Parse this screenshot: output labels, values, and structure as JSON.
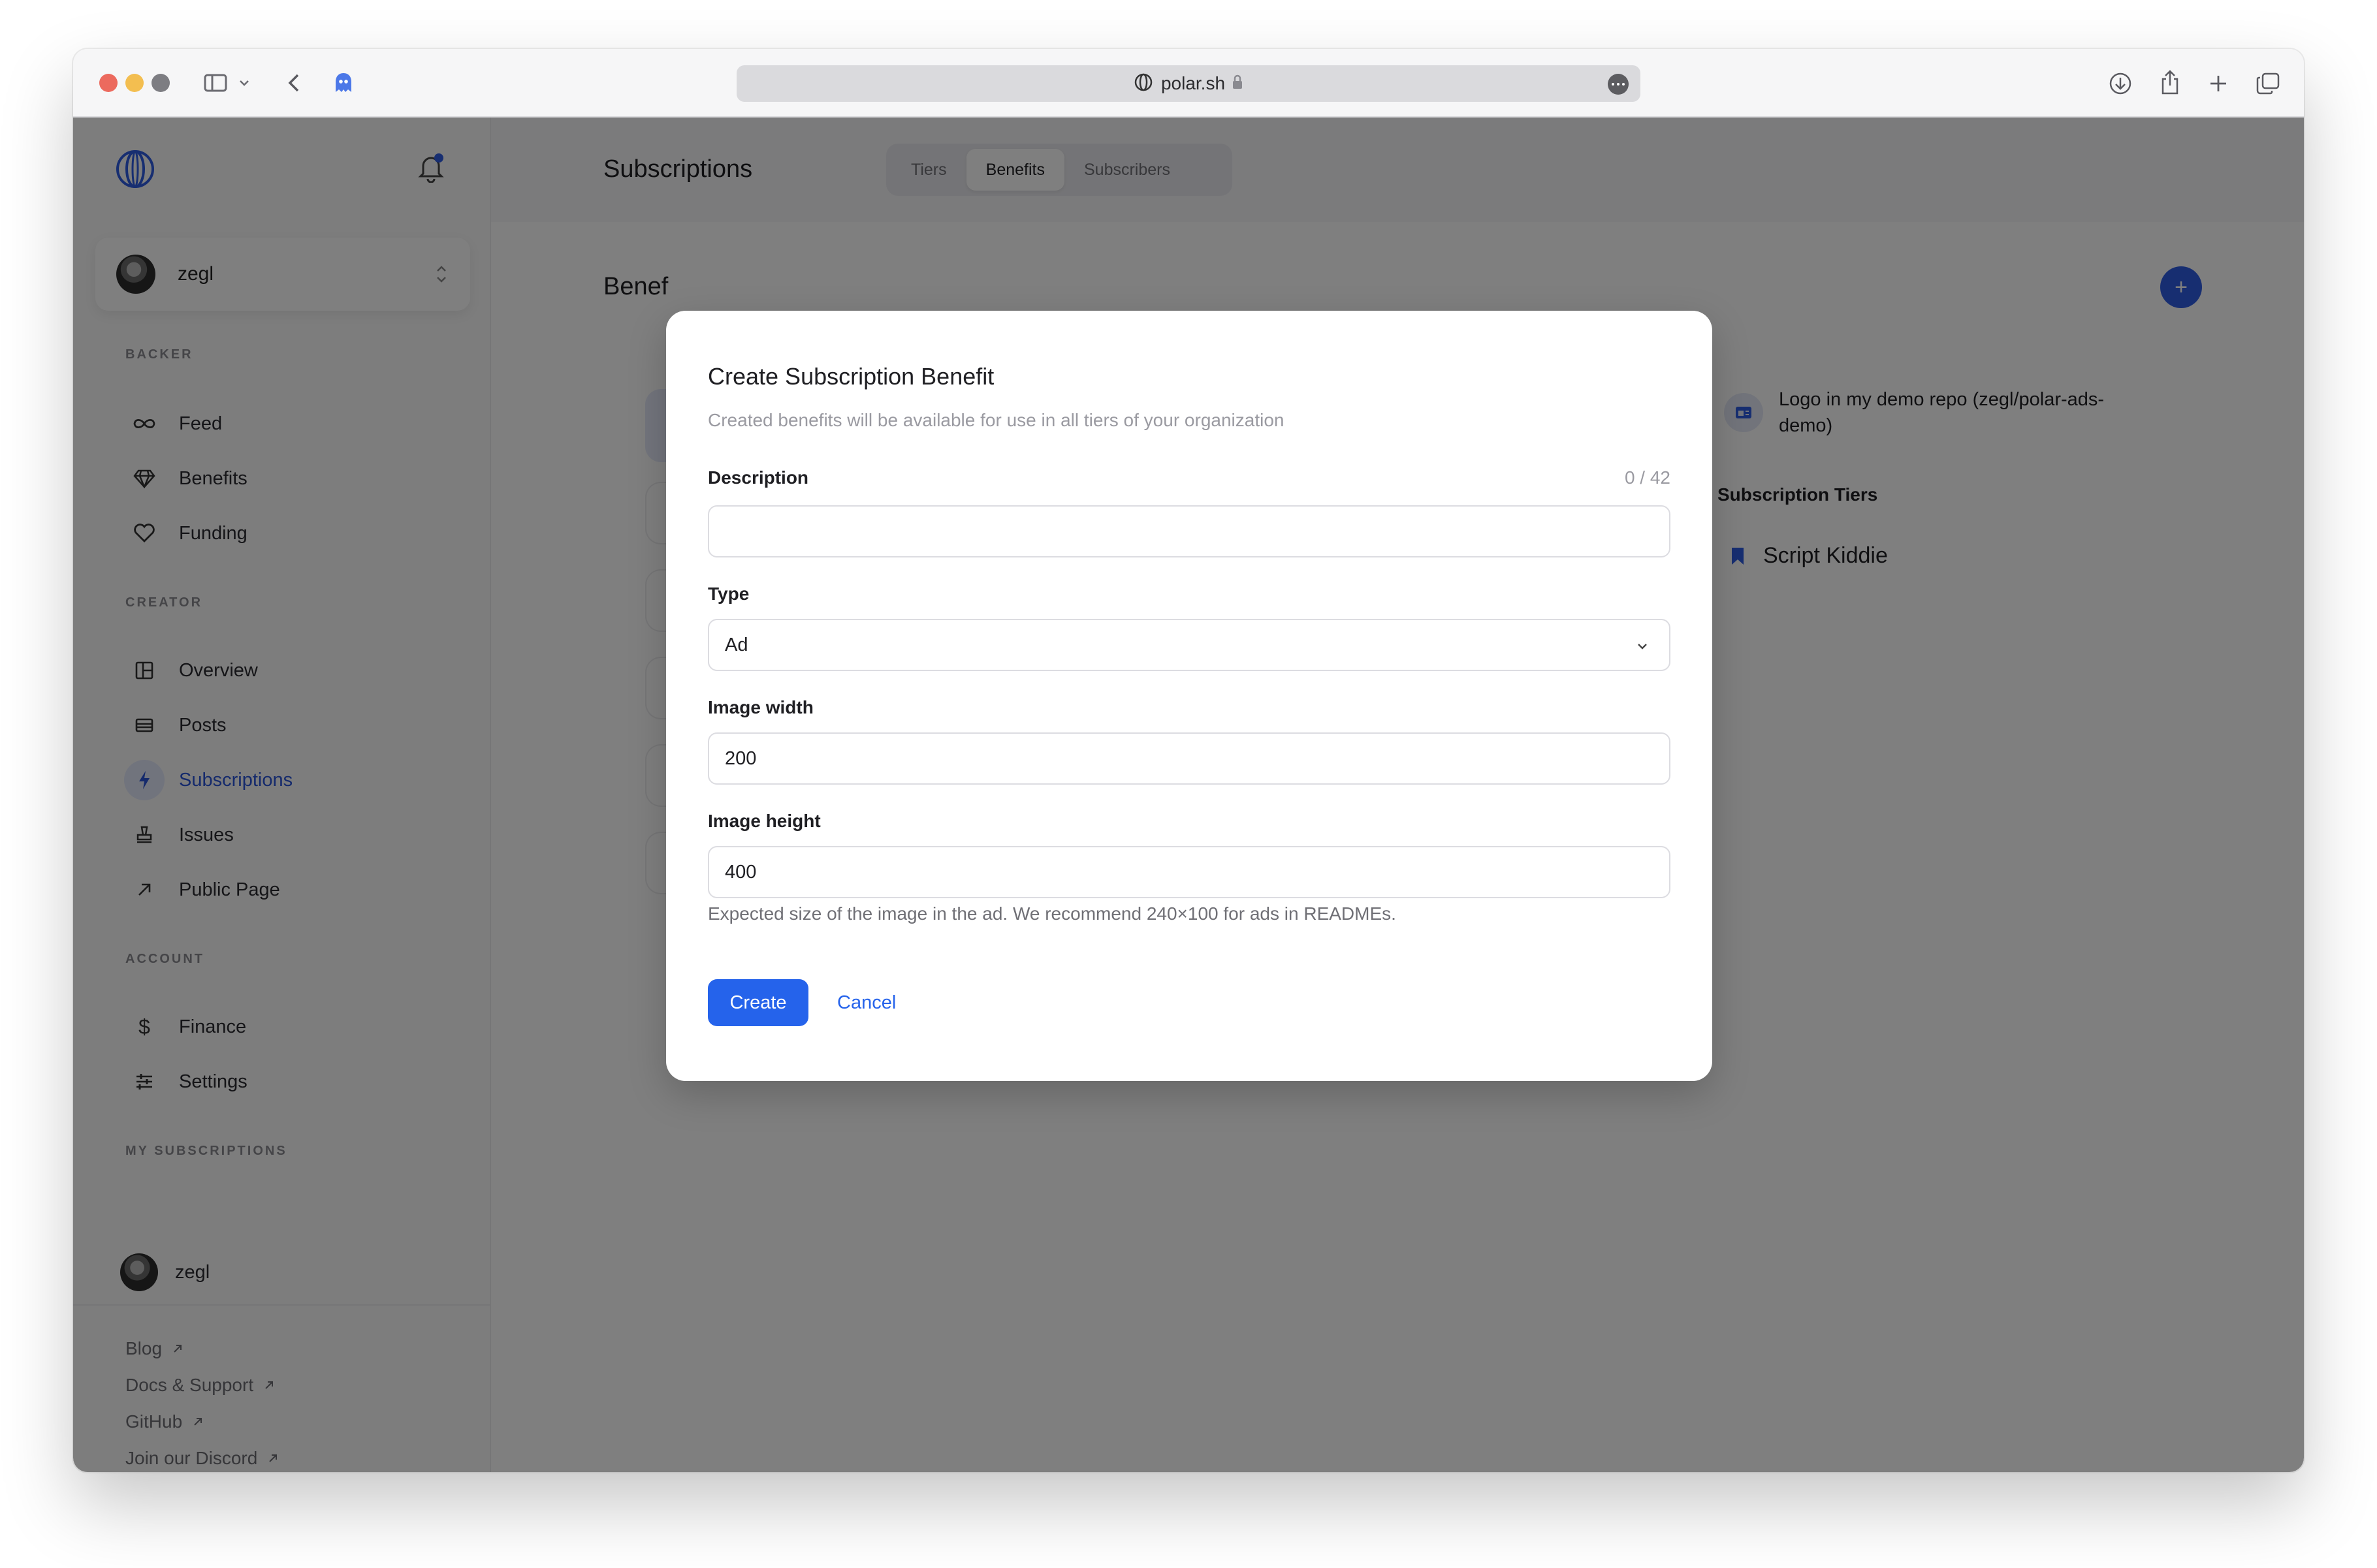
{
  "browser": {
    "url": "polar.sh"
  },
  "sidebar": {
    "account_name": "zegl",
    "sections": {
      "backer": "BACKER",
      "creator": "CREATOR",
      "account": "ACCOUNT",
      "my_subscriptions": "MY SUBSCRIPTIONS"
    },
    "backer_items": [
      {
        "label": "Feed",
        "icon": "infinity-icon"
      },
      {
        "label": "Benefits",
        "icon": "diamond-icon"
      },
      {
        "label": "Funding",
        "icon": "heart-icon"
      }
    ],
    "creator_items": [
      {
        "label": "Overview",
        "icon": "grid-icon"
      },
      {
        "label": "Posts",
        "icon": "posts-icon"
      },
      {
        "label": "Subscriptions",
        "icon": "bolt-icon",
        "active": true
      },
      {
        "label": "Issues",
        "icon": "stamp-icon"
      },
      {
        "label": "Public Page",
        "icon": "arrow-up-right-icon"
      }
    ],
    "account_items": [
      {
        "label": "Finance",
        "icon": "dollar-icon"
      },
      {
        "label": "Settings",
        "icon": "sliders-icon"
      }
    ],
    "subscriptions": [
      {
        "label": "zegl"
      }
    ],
    "footer_links": [
      {
        "label": "Blog"
      },
      {
        "label": "Docs & Support"
      },
      {
        "label": "GitHub"
      },
      {
        "label": "Join our Discord"
      }
    ]
  },
  "header": {
    "title": "Subscriptions",
    "tabs": [
      {
        "label": "Tiers"
      },
      {
        "label": "Benefits",
        "selected": true
      },
      {
        "label": "Subscribers"
      }
    ]
  },
  "main": {
    "heading": "Benef",
    "benefit_detail": {
      "description": "Logo in my demo repo (zegl/polar-ads-demo)",
      "tiers_label": "Subscription Tiers",
      "tiers": [
        "Script Kiddie"
      ]
    }
  },
  "modal": {
    "title": "Create Subscription Benefit",
    "subtitle": "Created benefits will be available for use in all tiers of your organization",
    "description_label": "Description",
    "description_counter": "0 / 42",
    "description_value": "",
    "type_label": "Type",
    "type_value": "Ad",
    "width_label": "Image width",
    "width_value": "200",
    "height_label": "Image height",
    "height_value": "400",
    "hint": "Expected size of the image in the ad. We recommend 240×100 for ads in READMEs.",
    "create_label": "Create",
    "cancel_label": "Cancel"
  },
  "colors": {
    "accent": "#2563eb",
    "active_nav": "#2b55d9",
    "overlay": "rgba(0,0,0,0.5)"
  }
}
